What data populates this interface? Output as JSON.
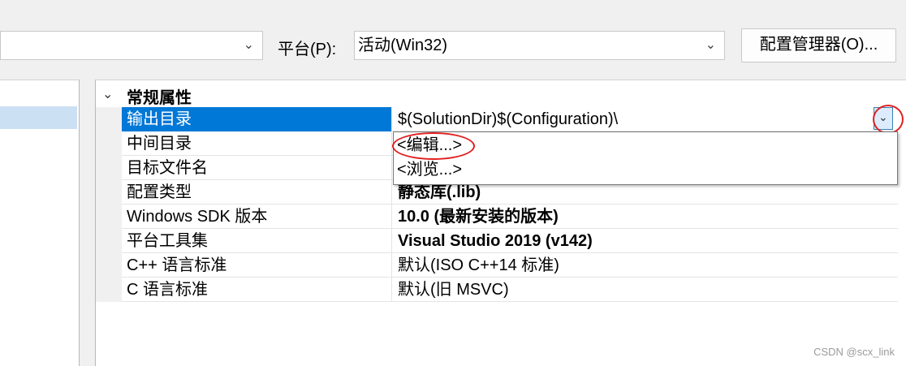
{
  "toolbar": {
    "configuration_value": "",
    "platform_label": "平台(P):",
    "platform_value": "活动(Win32)",
    "config_manager_label": "配置管理器(O)..."
  },
  "property_grid": {
    "category_title": "常规属性",
    "rows": [
      {
        "name": "输出目录",
        "value": "$(SolutionDir)$(Configuration)\\",
        "bold": false,
        "selected": true
      },
      {
        "name": "中间目录",
        "value": "",
        "bold": false
      },
      {
        "name": "目标文件名",
        "value": "",
        "bold": false
      },
      {
        "name": "配置类型",
        "value": "静态库(.lib)",
        "bold": true
      },
      {
        "name": "Windows SDK 版本",
        "value": "10.0 (最新安装的版本)",
        "bold": true
      },
      {
        "name": "平台工具集",
        "value": "Visual Studio 2019 (v142)",
        "bold": true
      },
      {
        "name": "C++ 语言标准",
        "value": "默认(ISO C++14 标准)",
        "bold": false
      },
      {
        "name": "C 语言标准",
        "value": "默认(旧 MSVC)",
        "bold": false
      }
    ]
  },
  "dropdown": {
    "items": [
      "<编辑...>",
      "<浏览...>"
    ]
  },
  "watermark": "CSDN @scx_link",
  "colors": {
    "selection": "#0078d7",
    "annotation": "#e02020"
  },
  "icons": {
    "collapse": "chevron-down-icon",
    "dropdown": "chevron-down-icon"
  }
}
